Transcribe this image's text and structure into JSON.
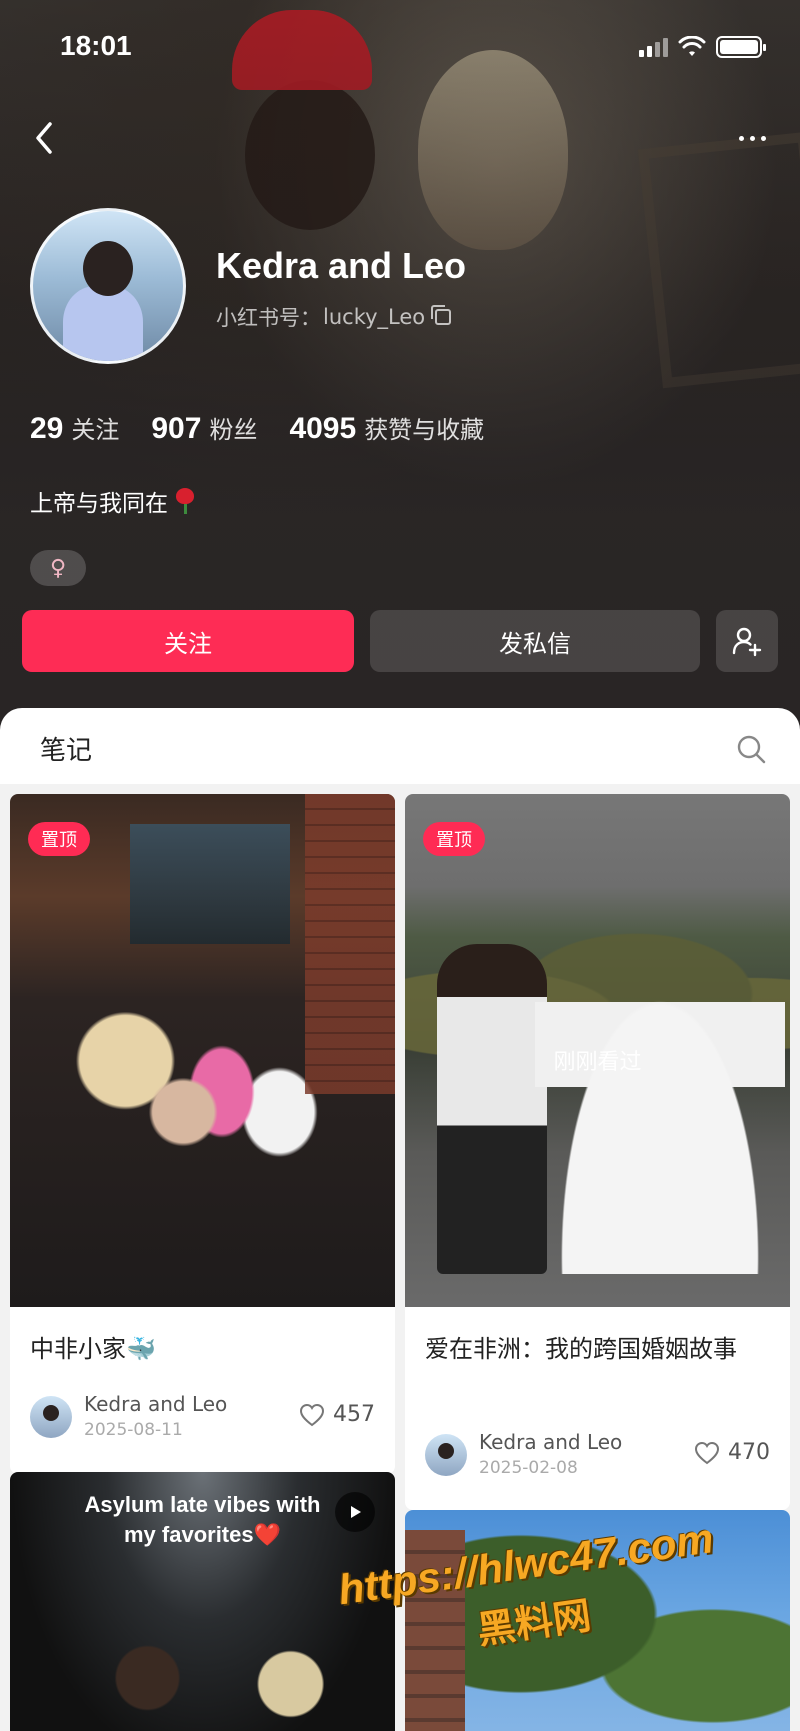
{
  "status_bar": {
    "time": "18:01"
  },
  "profile": {
    "name": "Kedra and Leo",
    "handle_label": "小红书号：",
    "handle": "lucky_Leo",
    "stats": [
      {
        "num": "29",
        "label": "关注"
      },
      {
        "num": "907",
        "label": "粉丝"
      },
      {
        "num": "4095",
        "label": "获赞与收藏"
      }
    ],
    "bio": "上帝与我同在",
    "gender_symbol": "♀"
  },
  "actions": {
    "follow": "关注",
    "message": "发私信"
  },
  "tabs": {
    "notes": "笔记"
  },
  "notes": [
    {
      "badge": "置顶",
      "title": "中非小家🐳",
      "author": "Kedra and Leo",
      "date": "2025-08-11",
      "likes": "457"
    },
    {
      "badge": "置顶",
      "overlay": "刚刚看过",
      "title": "爱在非洲：我的跨国婚姻故事",
      "author": "Kedra and Leo",
      "date": "2025-02-08",
      "likes": "470"
    },
    {
      "caption_line1": "Asylum late vibes with",
      "caption_line2": "my favorites❤️"
    },
    {}
  ],
  "watermark": {
    "url": "https://hlwc47.com",
    "site": "黑料网"
  },
  "colors": {
    "accent": "#fe2c55",
    "header_bg": "#2c2827"
  }
}
